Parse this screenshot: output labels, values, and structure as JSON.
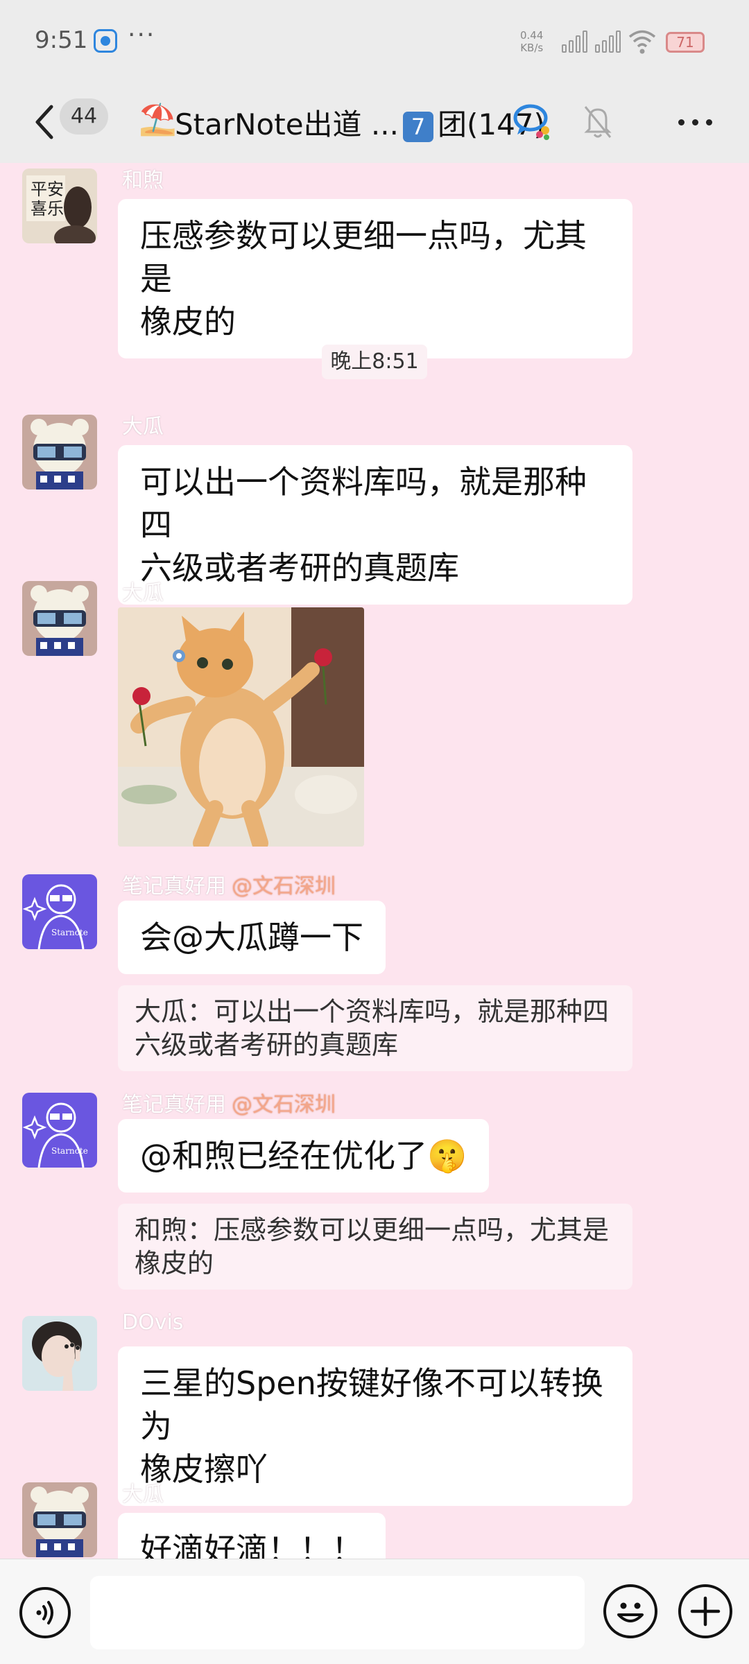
{
  "status_bar": {
    "time": "9:51",
    "dots": "···",
    "net_speed_value": "0.44",
    "net_speed_unit": "KB/s",
    "battery": "71"
  },
  "header": {
    "unread_count": "44",
    "group_emoji": "⛱️",
    "title_prefix": "StarNote出道 ...",
    "title_number": "7",
    "title_suffix": "团(147)"
  },
  "messages": [
    {
      "sender": "和煦",
      "text_lines": [
        "压感参数可以更细一点吗，尤其是",
        "橡皮的"
      ]
    },
    {
      "time_divider": "晚上8:51"
    },
    {
      "sender": "大瓜",
      "text_lines": [
        "可以出一个资料库吗，就是那种四",
        "六级或者考研的真题库"
      ]
    },
    {
      "sender": "大瓜",
      "type": "sticker"
    },
    {
      "sender": "笔记真好用",
      "role": "@文石深圳",
      "text": "会@大瓜蹲一下",
      "quote_lines": [
        "大瓜：可以出一个资料库吗，就是那种四",
        "六级或者考研的真题库"
      ]
    },
    {
      "sender": "笔记真好用",
      "role": "@文石深圳",
      "text": "@和煦已经在优化了🤫",
      "quote_lines": [
        "和煦：压感参数可以更细一点吗，尤其是",
        "橡皮的"
      ]
    },
    {
      "sender": "DOvis",
      "text_lines": [
        "三星的Spen按键好像不可以转换为",
        "橡皮擦吖"
      ]
    },
    {
      "sender": "大瓜",
      "text": "好滴好滴！！！"
    }
  ],
  "input": {
    "placeholder": ""
  },
  "icons": {
    "back": "chevron-left-icon",
    "group_chat": "chat-bubble-icon",
    "mute": "bell-muted-icon",
    "more": "more-dots-icon",
    "voice": "voice-icon",
    "emoji": "smiley-icon",
    "plus": "plus-icon"
  },
  "colors": {
    "background": "#fde4ee",
    "bar": "#ececec",
    "bubble": "#ffffff",
    "role_tag": "#f4a68a",
    "number_badge": "#3f7fc9"
  }
}
